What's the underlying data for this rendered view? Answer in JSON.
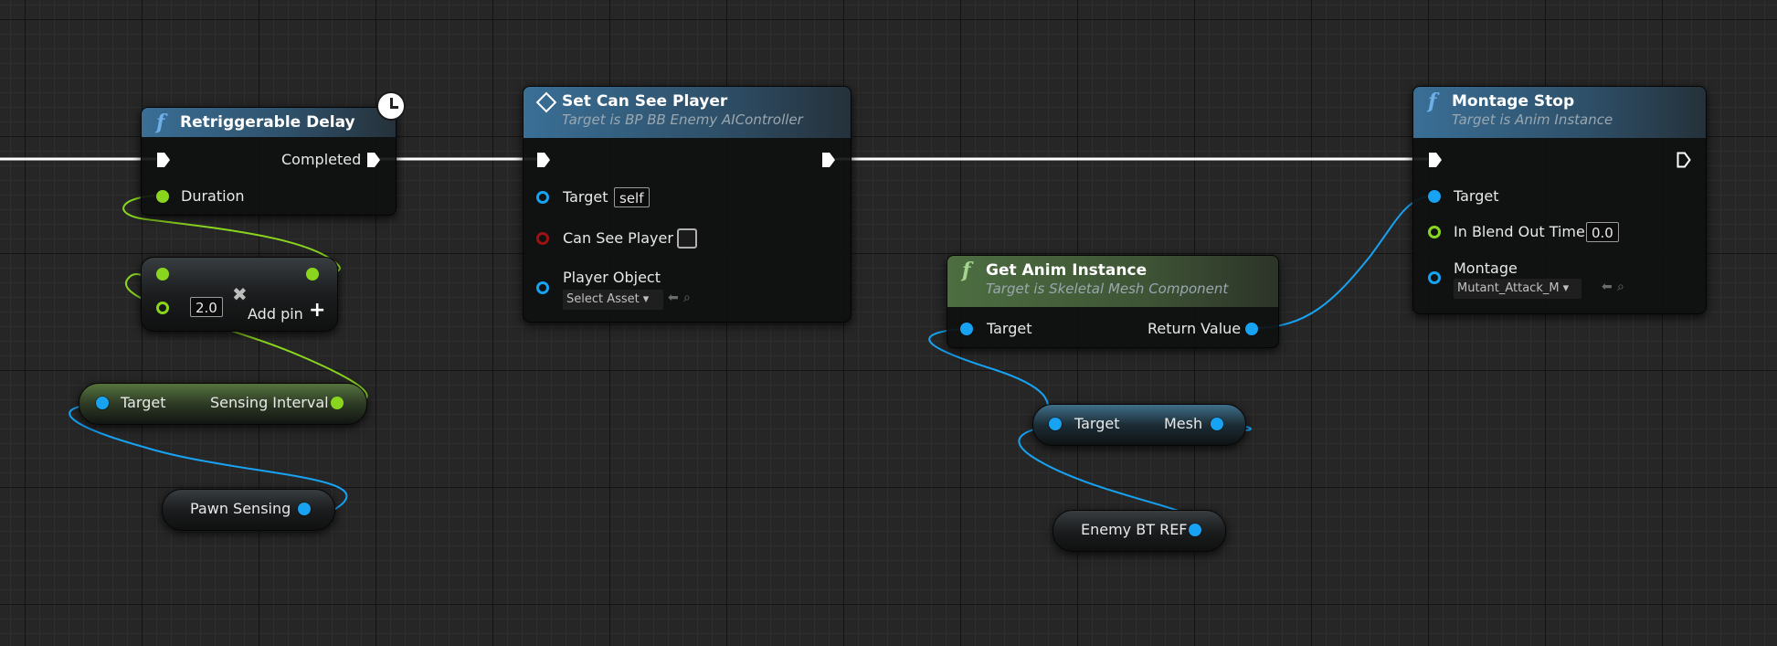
{
  "nodes": {
    "retriggerable_delay": {
      "title": "Retriggerable Delay",
      "completed_label": "Completed",
      "duration_label": "Duration"
    },
    "set_can_see_player": {
      "title": "Set Can See Player",
      "subtitle": "Target is BP BB Enemy AIController",
      "target_label": "Target",
      "target_value": "self",
      "can_see_label": "Can See Player",
      "player_object_label": "Player Object",
      "asset_placeholder": "Select Asset"
    },
    "montage_stop": {
      "title": "Montage Stop",
      "subtitle": "Target is Anim Instance",
      "target_label": "Target",
      "blend_label": "In Blend Out Time",
      "blend_value": "0.0",
      "montage_label": "Montage",
      "montage_value": "Mutant_Attack_M"
    },
    "get_anim_instance": {
      "title": "Get Anim Instance",
      "subtitle": "Target is Skeletal Mesh Component",
      "target_label": "Target",
      "return_label": "Return Value"
    },
    "multiply": {
      "value": "2.0",
      "add_pin_label": "Add pin"
    },
    "sensing_interval": {
      "target_label": "Target",
      "output_label": "Sensing Interval"
    },
    "pawn_sensing": {
      "label": "Pawn Sensing"
    },
    "get_mesh": {
      "target_label": "Target",
      "output_label": "Mesh"
    },
    "enemy_bt_ref": {
      "label": "Enemy BT REF"
    }
  },
  "icons": {
    "function": "f",
    "event": "diamond-icon",
    "clock": "clock-icon",
    "remove_pin": "close-icon",
    "add_pin": "plus-icon",
    "asset_use": "arrow-left-icon",
    "asset_browse": "search-icon",
    "dropdown": "chevron-down-icon"
  },
  "colors": {
    "exec_wire": "#ffffff",
    "float_wire": "#8ad61f",
    "object_wire": "#17a3f2",
    "bool_pin": "#9e1111",
    "function_header": "#3a6f96",
    "pure_header": "#4d6e41"
  }
}
